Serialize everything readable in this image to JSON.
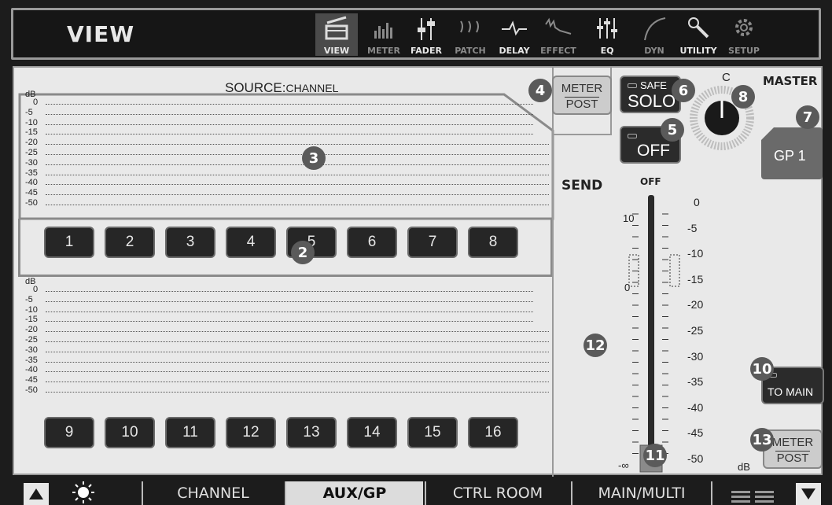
{
  "header": {
    "title": "VIEW",
    "tools": [
      {
        "label": "VIEW",
        "icon": "view-icon"
      },
      {
        "label": "METER",
        "icon": "meter-icon"
      },
      {
        "label": "FADER",
        "icon": "fader-icon"
      },
      {
        "label": "PATCH",
        "icon": "patch-icon"
      },
      {
        "label": "DELAY",
        "icon": "delay-icon"
      },
      {
        "label": "EFFECT",
        "icon": "effect-icon"
      },
      {
        "label": "EQ",
        "icon": "eq-icon"
      },
      {
        "label": "DYN",
        "icon": "dyn-icon"
      },
      {
        "label": "UTILITY",
        "icon": "utility-icon"
      },
      {
        "label": "SETUP",
        "icon": "setup-icon"
      }
    ]
  },
  "source": {
    "prefix": "SOURCE:",
    "value": "CHANNEL"
  },
  "meter_scale": {
    "unit": "dB",
    "labels": [
      "0",
      "-5",
      "-10",
      "-15",
      "-20",
      "-25",
      "-30",
      "-35",
      "-40",
      "-45",
      "-50"
    ]
  },
  "channels_top": [
    "1",
    "2",
    "3",
    "4",
    "5",
    "6",
    "7",
    "8"
  ],
  "channels_bottom": [
    "9",
    "10",
    "11",
    "12",
    "13",
    "14",
    "15",
    "16"
  ],
  "meter_post_top": {
    "top": "METER",
    "bottom": "POST"
  },
  "safe_solo": {
    "small": "SAFE",
    "main": "SOLO"
  },
  "off_button": "OFF",
  "pan": {
    "label": "C"
  },
  "master": {
    "label": "MASTER",
    "button": "GP 1"
  },
  "send": {
    "label": "SEND",
    "off_label": "OFF",
    "left_scale": [
      "10",
      "0",
      "-∞"
    ],
    "right_scale": [
      "0",
      "-5",
      "-10",
      "-15",
      "-20",
      "-25",
      "-30",
      "-35",
      "-40",
      "-45",
      "-50"
    ],
    "unit": "dB"
  },
  "to_main": "TO MAIN",
  "meter_post_bottom": {
    "top": "METER",
    "bottom": "POST"
  },
  "badges": [
    "2",
    "3",
    "4",
    "5",
    "6",
    "7",
    "8",
    "10",
    "11",
    "12",
    "13"
  ],
  "bottom": {
    "tabs": [
      "CHANNEL",
      "AUX/GP",
      "CTRL ROOM",
      "MAIN/MULTI"
    ],
    "active_tab": "AUX/GP"
  },
  "colors": {
    "panel": "#e9e9e9",
    "frame": "#1c1c1c",
    "button": "#262626"
  }
}
